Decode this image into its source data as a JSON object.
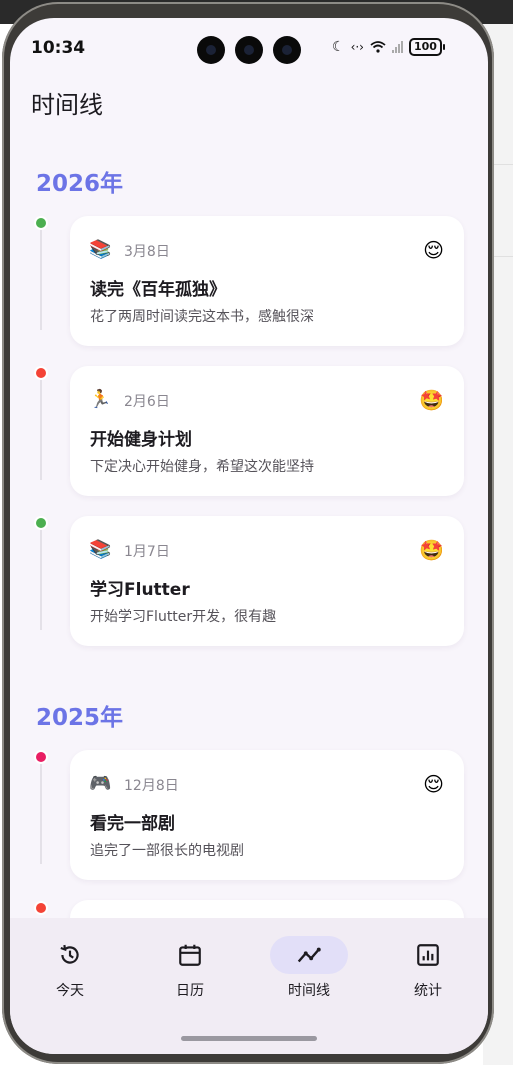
{
  "status_bar": {
    "time": "10:34",
    "battery": "100"
  },
  "header": {
    "title": "时间线"
  },
  "sections": [
    {
      "year": "2026年"
    },
    {
      "year": "2025年"
    }
  ],
  "entries": [
    {
      "icon": "📚",
      "date": "3月8日",
      "mood": "😌",
      "title": "读完《百年孤独》",
      "desc": "花了两周时间读完这本书，感触很深",
      "dot_color": "#4caf50"
    },
    {
      "icon": "🏃",
      "date": "2月6日",
      "mood": "🤩",
      "title": "开始健身计划",
      "desc": "下定决心开始健身，希望这次能坚持",
      "dot_color": "#f44336"
    },
    {
      "icon": "📚",
      "date": "1月7日",
      "mood": "🤩",
      "title": "学习Flutter",
      "desc": "开始学习Flutter开发，很有趣",
      "dot_color": "#4caf50"
    },
    {
      "icon": "🎮",
      "date": "12月8日",
      "mood": "😌",
      "title": "看完一部剧",
      "desc": "追完了一部很长的电视剧",
      "dot_color": "#e91e63"
    }
  ],
  "extra_dot_color": "#f44336",
  "nav": {
    "items": [
      {
        "label": "今天",
        "icon": "history-icon"
      },
      {
        "label": "日历",
        "icon": "calendar-icon"
      },
      {
        "label": "时间线",
        "icon": "timeline-icon",
        "active": true
      },
      {
        "label": "统计",
        "icon": "chart-icon"
      }
    ]
  },
  "colors": {
    "accent": "#6c74e6",
    "background": "#f8f5fb",
    "nav_active": "#e2dff8"
  }
}
